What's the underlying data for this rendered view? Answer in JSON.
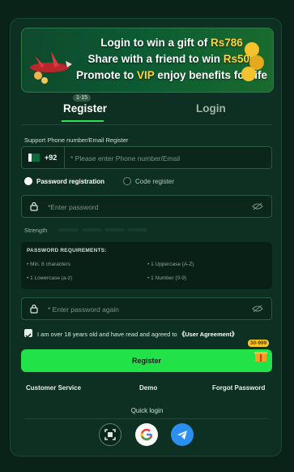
{
  "banner": {
    "line1_pre": "Login to win a gift of ",
    "line1_amount": "Rs786",
    "line2_pre": "Share with a friend to win ",
    "line2_amount": "Rs500",
    "line3_pre": "Promote to ",
    "line3_vip": "VIP",
    "line3_post": " enjoy benefits for life"
  },
  "tabs": {
    "register": "Register",
    "badge": "1-15",
    "login": "Login"
  },
  "phone": {
    "label": "Support Phone number/Email Register",
    "code": "+92",
    "placeholder": "* Please enter Phone number/Email"
  },
  "options": {
    "password_registration": "Password registration",
    "code_register": "Code register"
  },
  "password": {
    "placeholder": "*Enter password",
    "strength_label": "Strength"
  },
  "requirements": {
    "title": "PASSWORD REQUIREMENTS:",
    "items": [
      "• Min. 8 characters",
      "• 1 Uppercase (A-Z)",
      "• 1 Lowercase (a-z)",
      "• 1 Number (0-9)"
    ]
  },
  "password_again": {
    "placeholder": "* Enter password again"
  },
  "agreement": {
    "text": "I am over 18 years old and have read and agreed to ",
    "link": "《User Agreement》"
  },
  "register_button": "Register",
  "gift_badge": "30-999",
  "footer_links": {
    "customer_service": "Customer Service",
    "demo": "Demo",
    "forgot_password": "Forgot Password"
  },
  "quick_login": {
    "title": "Quick login",
    "icons": [
      "scan-icon",
      "google-icon",
      "telegram-icon"
    ]
  },
  "colors": {
    "accent": "#22e24a",
    "background": "#0a2318",
    "card": "#0d3022",
    "highlight": "#ffd23a"
  }
}
